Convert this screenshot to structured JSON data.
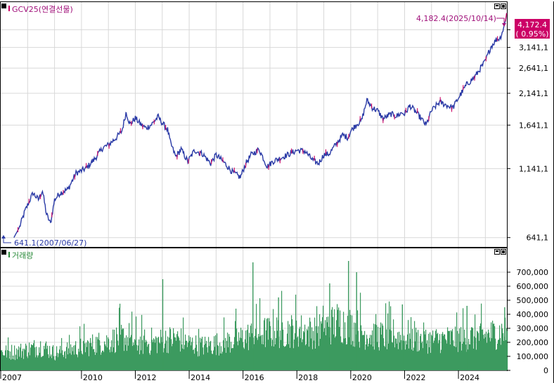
{
  "price_panel": {
    "title": "GCV25(연결선물)",
    "max_annotation": "4,182.4(2025/10/14)",
    "min_annotation": "641.1(2007/06/27)",
    "last_price": "4,172.4",
    "last_change": "( 0.95%)"
  },
  "volume_panel": {
    "title": "거래량"
  },
  "colors": {
    "price_line": "#2a3aa6",
    "price_up": "#d0106a",
    "volume_bar": "#3c9a5f",
    "highlight": "#cc0066",
    "title_price": "#a0107a",
    "title_volume": "#2a8a3a",
    "grid": "#d8d8d8",
    "frame": "#000000"
  },
  "chart_data": [
    {
      "type": "line",
      "title": "GCV25(연결선물)",
      "y_ticks": [
        "641,1",
        "1,141,1",
        "1,641,1",
        "2,141,1",
        "2,641,1",
        "3,141,1",
        "3,641,1"
      ],
      "y_tick_values": [
        641.1,
        1141.1,
        1641.1,
        2141.1,
        2641.1,
        3141.1,
        3641.1
      ],
      "ylim": [
        600,
        4300
      ],
      "y_scale": "log",
      "x_ticks": [
        "2007",
        "2010",
        "2012",
        "2014",
        "2016",
        "2018",
        "2020",
        "2022",
        "2024"
      ],
      "x_tick_years": [
        2007.0,
        2010.0,
        2012.0,
        2014.0,
        2016.0,
        2018.0,
        2020.0,
        2022.0,
        2024.0
      ],
      "xlim": [
        2007.0,
        2025.8
      ],
      "series": [
        {
          "points": [
            [
              2007.49,
              641.1
            ],
            [
              2007.7,
              700
            ],
            [
              2007.9,
              800
            ],
            [
              2008.2,
              930
            ],
            [
              2008.4,
              880
            ],
            [
              2008.55,
              950
            ],
            [
              2008.7,
              780
            ],
            [
              2008.85,
              720
            ],
            [
              2009.0,
              880
            ],
            [
              2009.2,
              930
            ],
            [
              2009.5,
              960
            ],
            [
              2009.8,
              1100
            ],
            [
              2010.0,
              1120
            ],
            [
              2010.2,
              1150
            ],
            [
              2010.5,
              1240
            ],
            [
              2010.8,
              1360
            ],
            [
              2011.0,
              1390
            ],
            [
              2011.3,
              1480
            ],
            [
              2011.5,
              1560
            ],
            [
              2011.66,
              1830
            ],
            [
              2011.8,
              1650
            ],
            [
              2012.0,
              1740
            ],
            [
              2012.2,
              1650
            ],
            [
              2012.4,
              1600
            ],
            [
              2012.6,
              1650
            ],
            [
              2012.85,
              1760
            ],
            [
              2013.0,
              1670
            ],
            [
              2013.2,
              1580
            ],
            [
              2013.3,
              1420
            ],
            [
              2013.5,
              1260
            ],
            [
              2013.7,
              1340
            ],
            [
              2013.95,
              1210
            ],
            [
              2014.2,
              1330
            ],
            [
              2014.5,
              1290
            ],
            [
              2014.8,
              1190
            ],
            [
              2015.0,
              1280
            ],
            [
              2015.3,
              1200
            ],
            [
              2015.6,
              1110
            ],
            [
              2015.9,
              1060
            ],
            [
              2016.1,
              1190
            ],
            [
              2016.3,
              1280
            ],
            [
              2016.6,
              1340
            ],
            [
              2016.9,
              1160
            ],
            [
              2017.1,
              1210
            ],
            [
              2017.5,
              1260
            ],
            [
              2017.8,
              1300
            ],
            [
              2018.0,
              1330
            ],
            [
              2018.3,
              1320
            ],
            [
              2018.6,
              1220
            ],
            [
              2018.8,
              1190
            ],
            [
              2019.0,
              1280
            ],
            [
              2019.2,
              1290
            ],
            [
              2019.5,
              1420
            ],
            [
              2019.7,
              1510
            ],
            [
              2019.9,
              1480
            ],
            [
              2020.0,
              1560
            ],
            [
              2020.2,
              1650
            ],
            [
              2020.4,
              1700
            ],
            [
              2020.6,
              2020
            ],
            [
              2020.8,
              1900
            ],
            [
              2021.0,
              1850
            ],
            [
              2021.2,
              1730
            ],
            [
              2021.5,
              1800
            ],
            [
              2021.7,
              1770
            ],
            [
              2021.9,
              1820
            ],
            [
              2022.0,
              1800
            ],
            [
              2022.2,
              1930
            ],
            [
              2022.4,
              1840
            ],
            [
              2022.6,
              1740
            ],
            [
              2022.8,
              1640
            ],
            [
              2023.0,
              1850
            ],
            [
              2023.3,
              1990
            ],
            [
              2023.6,
              1930
            ],
            [
              2023.8,
              1900
            ],
            [
              2024.0,
              2060
            ],
            [
              2024.3,
              2300
            ],
            [
              2024.6,
              2450
            ],
            [
              2024.8,
              2620
            ],
            [
              2025.0,
              2800
            ],
            [
              2025.2,
              3150
            ],
            [
              2025.4,
              3350
            ],
            [
              2025.55,
              3400
            ],
            [
              2025.7,
              3750
            ],
            [
              2025.79,
              4182.4
            ]
          ]
        }
      ]
    },
    {
      "type": "bar",
      "title": "거래량",
      "y_ticks": [
        "0",
        "100,000",
        "200,000",
        "300,000",
        "400,000",
        "500,000",
        "600,000",
        "700,000"
      ],
      "y_tick_values": [
        0,
        100000,
        200000,
        300000,
        400000,
        500000,
        600000,
        700000
      ],
      "ylim": [
        0,
        780000
      ],
      "x_ticks": [
        "2007",
        "2010",
        "2012",
        "2014",
        "2016",
        "2018",
        "2020",
        "2022",
        "2024"
      ],
      "x_tick_years": [
        2007.0,
        2010.0,
        2012.0,
        2014.0,
        2016.0,
        2018.0,
        2020.0,
        2022.0,
        2024.0
      ],
      "xlim": [
        2007.0,
        2025.8
      ],
      "series": [
        {
          "points": [
            [
              2007.5,
              160000
            ],
            [
              2008.0,
              180000
            ],
            [
              2008.5,
              210000
            ],
            [
              2009.0,
              150000
            ],
            [
              2009.5,
              180000
            ],
            [
              2010.0,
              200000
            ],
            [
              2010.5,
              230000
            ],
            [
              2011.0,
              250000
            ],
            [
              2011.5,
              290000
            ],
            [
              2012.0,
              240000
            ],
            [
              2012.5,
              230000
            ],
            [
              2013.0,
              260000
            ],
            [
              2013.5,
              280000
            ],
            [
              2014.0,
              230000
            ],
            [
              2014.5,
              210000
            ],
            [
              2015.0,
              230000
            ],
            [
              2015.5,
              250000
            ],
            [
              2016.0,
              280000
            ],
            [
              2016.5,
              320000
            ],
            [
              2017.0,
              330000
            ],
            [
              2017.5,
              340000
            ],
            [
              2018.0,
              350000
            ],
            [
              2018.5,
              330000
            ],
            [
              2019.0,
              360000
            ],
            [
              2019.5,
              420000
            ],
            [
              2020.0,
              380000
            ],
            [
              2020.5,
              320000
            ],
            [
              2021.0,
              300000
            ],
            [
              2021.5,
              290000
            ],
            [
              2022.0,
              280000
            ],
            [
              2022.5,
              270000
            ],
            [
              2023.0,
              260000
            ],
            [
              2023.5,
              270000
            ],
            [
              2024.0,
              280000
            ],
            [
              2024.5,
              290000
            ],
            [
              2025.0,
              300000
            ],
            [
              2025.5,
              330000
            ]
          ],
          "spikes": [
            [
              2013.0,
              650000
            ],
            [
              2016.35,
              770000
            ],
            [
              2017.3,
              520000
            ],
            [
              2019.2,
              620000
            ],
            [
              2019.9,
              780000
            ],
            [
              2020.2,
              700000
            ],
            [
              2021.9,
              470000
            ],
            [
              2024.3,
              460000
            ],
            [
              2025.7,
              450000
            ]
          ]
        }
      ]
    }
  ]
}
